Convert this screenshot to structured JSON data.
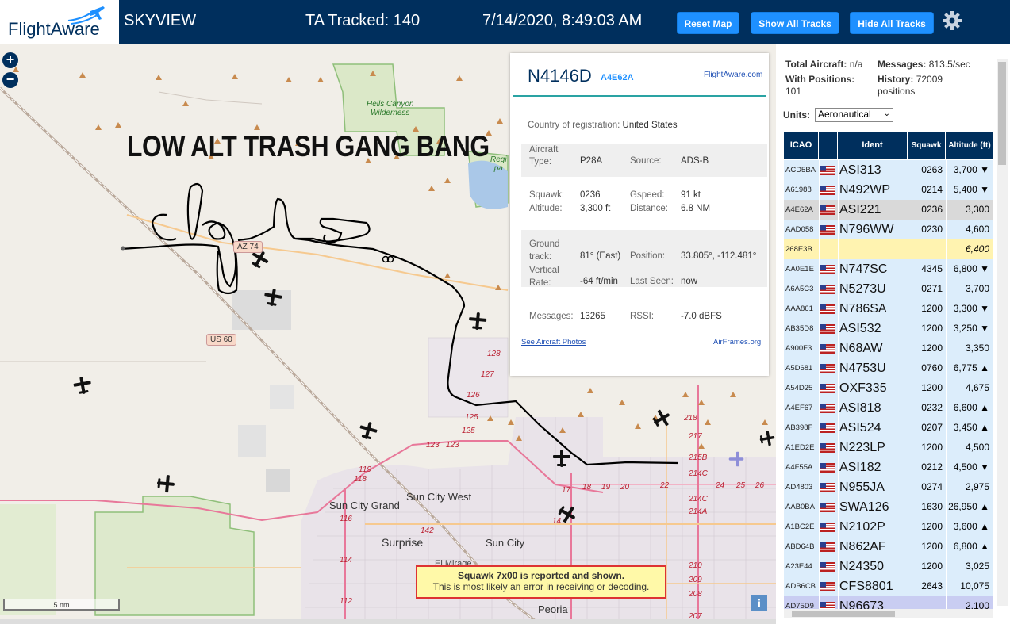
{
  "header": {
    "logo_text": "FlightAware",
    "title": "SKYVIEW",
    "tracked": "TA Tracked: 140",
    "datetime": "7/14/2020, 8:49:03 AM",
    "buttons": {
      "reset": "Reset Map",
      "show_all": "Show All Tracks",
      "hide_all": "Hide All Tracks"
    }
  },
  "map": {
    "zoom_in": "+",
    "zoom_out": "−",
    "overlay_caption": "LOW ALT TRASH GANG BANG",
    "scale_label": "5 nm",
    "info": "i",
    "labels": {
      "hells_canyon": "Hells Canyon\nWilderness",
      "sun_city_grand": "Sun City Grand",
      "sun_city_west": "Sun City West",
      "surprise": "Surprise",
      "sun_city": "Sun City",
      "el_mirage": "El Mirage",
      "peoria": "Peoria",
      "us60": "US 60",
      "az74": "AZ 74",
      "regional": "Regi\npa"
    },
    "route_numbers": [
      "128",
      "127",
      "126",
      "125",
      "125",
      "123",
      "123",
      "119",
      "118",
      "116",
      "114",
      "112",
      "142",
      "17",
      "18",
      "19",
      "20",
      "22",
      "24",
      "25",
      "26",
      "218",
      "217",
      "215B",
      "214C",
      "214A",
      "214C",
      "210",
      "209",
      "208",
      "207",
      "14"
    ],
    "warning": {
      "line1": "Squawk 7x00 is reported and shown.",
      "line2": "This is most likely an error in receiving or decoding."
    }
  },
  "popup": {
    "registration": "N4146D",
    "hex": "A4E62A",
    "fa_link": "FlightAware.com",
    "country_label": "Country of registration:",
    "country": "United States",
    "aircraft_type_label": "Aircraft Type:",
    "aircraft_type": "P28A",
    "source_label": "Source:",
    "source": "ADS-B",
    "squawk_label": "Squawk:",
    "squawk": "0236",
    "gspeed_label": "Gspeed:",
    "gspeed": "91 kt",
    "altitude_label": "Altitude:",
    "altitude": "3,300 ft",
    "distance_label": "Distance:",
    "distance": "6.8 NM",
    "ground_track_label": "Ground track:",
    "ground_track": "81° (East)",
    "position_label": "Position:",
    "position": "33.805°, -112.481°",
    "vrate_label": "Vertical Rate:",
    "vrate": "-64 ft/min",
    "last_seen_label": "Last Seen:",
    "last_seen": "now",
    "messages_label": "Messages:",
    "messages": "13265",
    "rssi_label": "RSSI:",
    "rssi": "-7.0 dBFS",
    "photos_link": "See Aircraft Photos",
    "airframes_link": "AirFrames.org"
  },
  "sidebar": {
    "total_aircraft_label": "Total Aircraft:",
    "total_aircraft": "n/a",
    "messages_label": "Messages:",
    "messages": "813.5/sec",
    "with_positions_label": "With Positions:",
    "with_positions": "101",
    "history_label": "History:",
    "history": "72009",
    "history_unit": "positions",
    "units_label": "Units:",
    "units_value": "Aeronautical",
    "columns": [
      "ICAO",
      "Ident",
      "Squawk",
      "Altitude (ft)"
    ],
    "rows": [
      {
        "icao": "ACD5BA",
        "ident": "ASI313",
        "squawk": "0263",
        "alt": "3,700 ▼",
        "bg": "#dcedfb"
      },
      {
        "icao": "A61988",
        "ident": "N492WP",
        "squawk": "0214",
        "alt": "5,400 ▼",
        "bg": "#dcedfb"
      },
      {
        "icao": "A4E62A",
        "ident": "ASI221",
        "squawk": "0236",
        "alt": "3,300",
        "bg": "#d9d9d9"
      },
      {
        "icao": "AAD058",
        "ident": "N796WW",
        "squawk": "0230",
        "alt": "4,600",
        "bg": "#dcedfb"
      },
      {
        "icao": "268E3B",
        "ident": "",
        "squawk": "",
        "alt": "6,400",
        "bg": "#fff3b0",
        "italic": true
      },
      {
        "icao": "AA0E1E",
        "ident": "N747SC",
        "squawk": "4345",
        "alt": "6,800 ▼",
        "bg": "#dcedfb"
      },
      {
        "icao": "A6A5C3",
        "ident": "N5273U",
        "squawk": "0271",
        "alt": "3,700",
        "bg": "#dcedfb"
      },
      {
        "icao": "AAA861",
        "ident": "N786SA",
        "squawk": "1200",
        "alt": "3,300 ▼",
        "bg": "#dcedfb"
      },
      {
        "icao": "AB35D8",
        "ident": "ASI532",
        "squawk": "1200",
        "alt": "3,250 ▼",
        "bg": "#dcedfb"
      },
      {
        "icao": "A900F3",
        "ident": "N68AW",
        "squawk": "1200",
        "alt": "3,350",
        "bg": "#dcedfb"
      },
      {
        "icao": "A5D681",
        "ident": "N4753U",
        "squawk": "0760",
        "alt": "6,775 ▲",
        "bg": "#dcedfb"
      },
      {
        "icao": "A54D25",
        "ident": "OXF335",
        "squawk": "1200",
        "alt": "4,675",
        "bg": "#dcedfb"
      },
      {
        "icao": "A4EF67",
        "ident": "ASI818",
        "squawk": "0232",
        "alt": "6,600 ▲",
        "bg": "#dcedfb"
      },
      {
        "icao": "AB398F",
        "ident": "ASI524",
        "squawk": "0207",
        "alt": "3,450 ▲",
        "bg": "#dcedfb"
      },
      {
        "icao": "A1ED2E",
        "ident": "N223LP",
        "squawk": "1200",
        "alt": "4,500",
        "bg": "#dcedfb"
      },
      {
        "icao": "A4F55A",
        "ident": "ASI182",
        "squawk": "0212",
        "alt": "4,500 ▼",
        "bg": "#dcedfb"
      },
      {
        "icao": "AD4803",
        "ident": "N955JA",
        "squawk": "0274",
        "alt": "2,975",
        "bg": "#dcedfb"
      },
      {
        "icao": "AAB0BA",
        "ident": "SWA126",
        "squawk": "1630",
        "alt": "26,950 ▲",
        "bg": "#dcedfb"
      },
      {
        "icao": "A1BC2E",
        "ident": "N2102P",
        "squawk": "1200",
        "alt": "3,600 ▲",
        "bg": "#dcedfb"
      },
      {
        "icao": "ABD64B",
        "ident": "N862AF",
        "squawk": "1200",
        "alt": "6,800 ▲",
        "bg": "#dcedfb"
      },
      {
        "icao": "A23E44",
        "ident": "N24350",
        "squawk": "1200",
        "alt": "3,025",
        "bg": "#dcedfb"
      },
      {
        "icao": "ADB6CB",
        "ident": "CFS8801",
        "squawk": "2643",
        "alt": "10,075",
        "bg": "#dcedfb"
      },
      {
        "icao": "AD75D9",
        "ident": "N96673",
        "squawk": "",
        "alt": "2,100",
        "bg": "#c9cdf2"
      }
    ]
  }
}
